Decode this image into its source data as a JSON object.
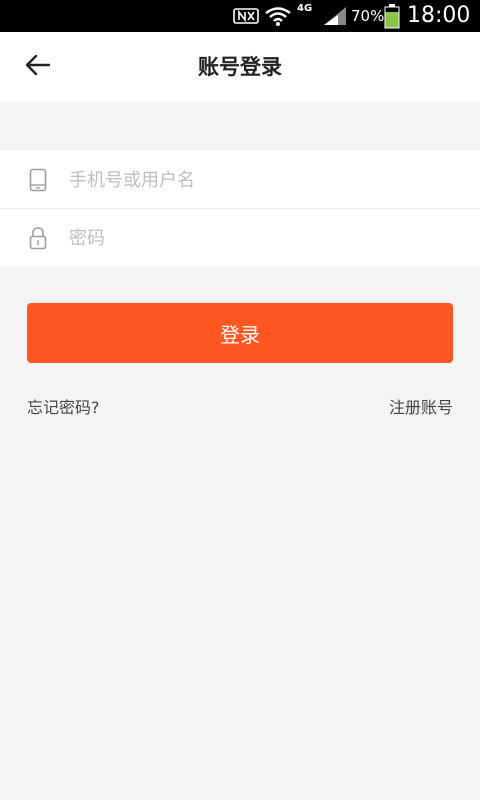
{
  "status_bar": {
    "network": "4G",
    "battery": "70%",
    "time": "18:00"
  },
  "header": {
    "back_icon": "arrow-left-icon",
    "title": "账号登录"
  },
  "form": {
    "username_placeholder": "手机号或用户名",
    "username_value": "",
    "username_icon": "phone-icon",
    "password_placeholder": "密码",
    "password_value": "",
    "password_icon": "lock-icon"
  },
  "actions": {
    "login_label": "登录",
    "forgot_label": "忘记密码?",
    "register_label": "注册账号"
  },
  "colors": {
    "accent": "#ff5722",
    "background": "#f4f4f4"
  }
}
